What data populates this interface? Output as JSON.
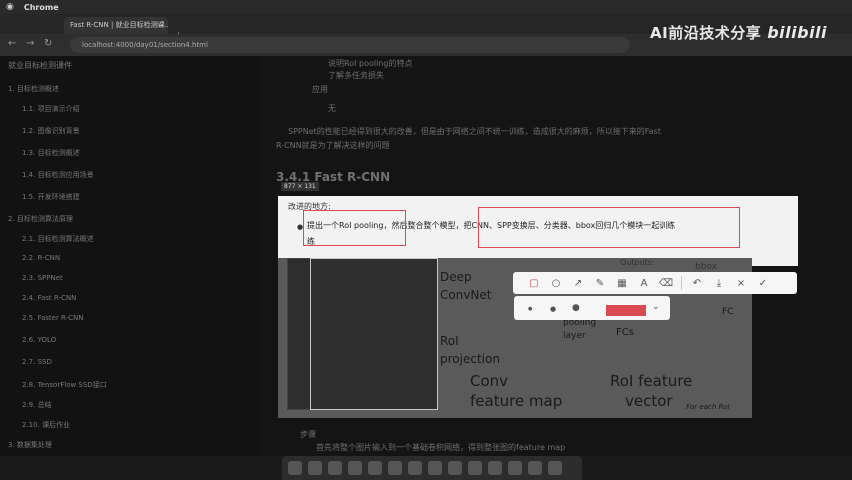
{
  "menubar": {
    "apple": "",
    "app": "Chrome"
  },
  "tab": {
    "title": "Fast R-CNN | 就业目标检测课...",
    "close": "×"
  },
  "url": {
    "text": "localhost:4000/day01/section4.html"
  },
  "watermark": {
    "text": "AI前沿技术分享",
    "bili": "bilibili"
  },
  "sidebar": {
    "title": "就业目标检测课件",
    "items": [
      "1. 目标检测概述",
      "1.1. 项目演示介绍",
      "1.2. 图像识别背景",
      "1.3. 目标检测概述",
      "1.4. 目标检测应用场景",
      "1.5. 开发环境搭建",
      "2. 目标检测算法原理",
      "2.1. 目标检测算法概述",
      "2.2. R-CNN",
      "2.3. SPPNet",
      "2.4. Fast R-CNN",
      "2.5. Faster R-CNN",
      "2.6. YOLO",
      "2.7. SSD",
      "2.8. TensorFlow SSD接口",
      "2.9. 总结",
      "2.10. 课后作业",
      "3. 数据集处理"
    ]
  },
  "content": {
    "line1": "说明RoI pooling的特点",
    "line2": "了解多任务损失",
    "bullet_apply": "应用",
    "none": "无",
    "para1": "SPPNet的性能已经得到很大的改善，但是由于网络之间不统一训练，造成很大的麻烦，所以接下来的Fast",
    "para2": "R-CNN就是为了解决这样的问题",
    "heading": "3.4.1 Fast R-CNN",
    "coord": "877 × 131",
    "improve_label": "改进的地方:",
    "improve_text": "提出一个RoI pooling，然后整合整个模型，把CNN、SPP变换层、分类器、bbox回归几个模块一起训练",
    "improve_cont": "练",
    "steps": "步骤",
    "step1": "首先将整个图片输入到一个基础卷积网络，得到整张图的feature map"
  },
  "figure": {
    "deep": "Deep",
    "convnet": "ConvNet",
    "roi": "RoI",
    "projection": "projection",
    "conv": "Conv",
    "feature_map": "feature map",
    "pooling": "pooling",
    "layer": "layer",
    "fcs": "FCs",
    "fc": "FC",
    "bbox": "bbox",
    "outputs": "Outputs:",
    "roi_feature": "RoI feature",
    "vector": "vector",
    "for_each": "For each RoI"
  },
  "toolbar": {
    "tools": [
      "rect-icon",
      "circle-icon",
      "arrow-icon",
      "pen-icon",
      "mosaic-icon",
      "text-icon",
      "eraser-icon"
    ],
    "undo": "↶",
    "download": "⤓",
    "close": "×",
    "confirm": "✓"
  },
  "colors": {
    "accent": "#d94a55"
  }
}
